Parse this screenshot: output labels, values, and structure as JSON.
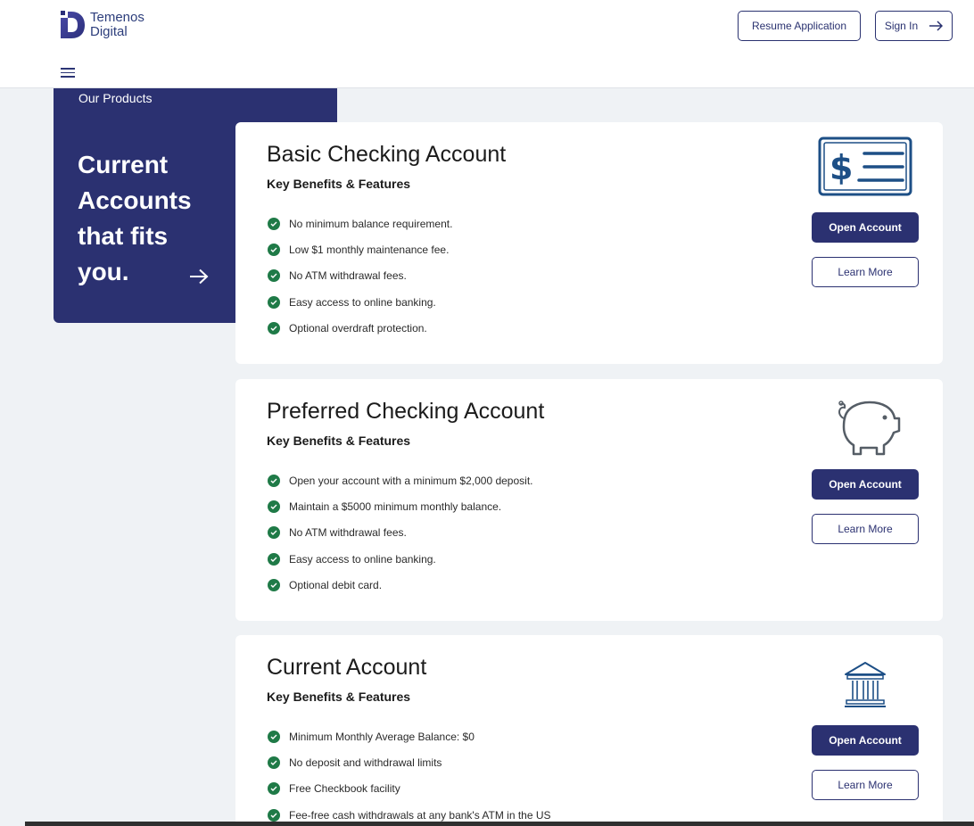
{
  "brand": {
    "name_line1": "Temenos",
    "name_line2": "Digital"
  },
  "header": {
    "resume_label": "Resume Application",
    "signin_label": "Sign In",
    "menu_icon": "hamburger-icon",
    "signin_icon": "arrow-right-icon"
  },
  "promo": {
    "eyebrow": "Our Products",
    "title": "Current Accounts that fits you.",
    "arrow_icon": "arrow-right-icon"
  },
  "cards": [
    {
      "title": "Basic Checking Account",
      "subtitle": "Key Benefits & Features",
      "icon": "check-dollar-icon",
      "features": [
        "No minimum balance requirement.",
        "Low $1 monthly maintenance fee.",
        "No ATM withdrawal fees.",
        "Easy access to online banking.",
        "Optional overdraft protection."
      ],
      "open_label": "Open Account",
      "learn_label": "Learn More"
    },
    {
      "title": "Preferred Checking Account",
      "subtitle": "Key Benefits & Features",
      "icon": "piggy-bank-icon",
      "features": [
        "Open your account with a minimum $2,000 deposit.",
        "Maintain a $5000 minimum monthly balance.",
        "No ATM withdrawal fees.",
        "Easy access to online banking.",
        "Optional debit card."
      ],
      "open_label": "Open Account",
      "learn_label": "Learn More"
    },
    {
      "title": "Current Account",
      "subtitle": "Key Benefits & Features",
      "icon": "bank-building-icon",
      "features": [
        "Minimum Monthly Average Balance: $0",
        "No deposit and withdrawal limits",
        "Free Checkbook facility",
        "Fee-free cash withdrawals at any bank's ATM in the US"
      ],
      "open_label": "Open Account",
      "learn_label": "Learn More"
    }
  ],
  "colors": {
    "primary": "#2b3171",
    "check_green": "#1f7a47",
    "background": "#eff2f5",
    "icon_blue": "#1d4f86"
  }
}
